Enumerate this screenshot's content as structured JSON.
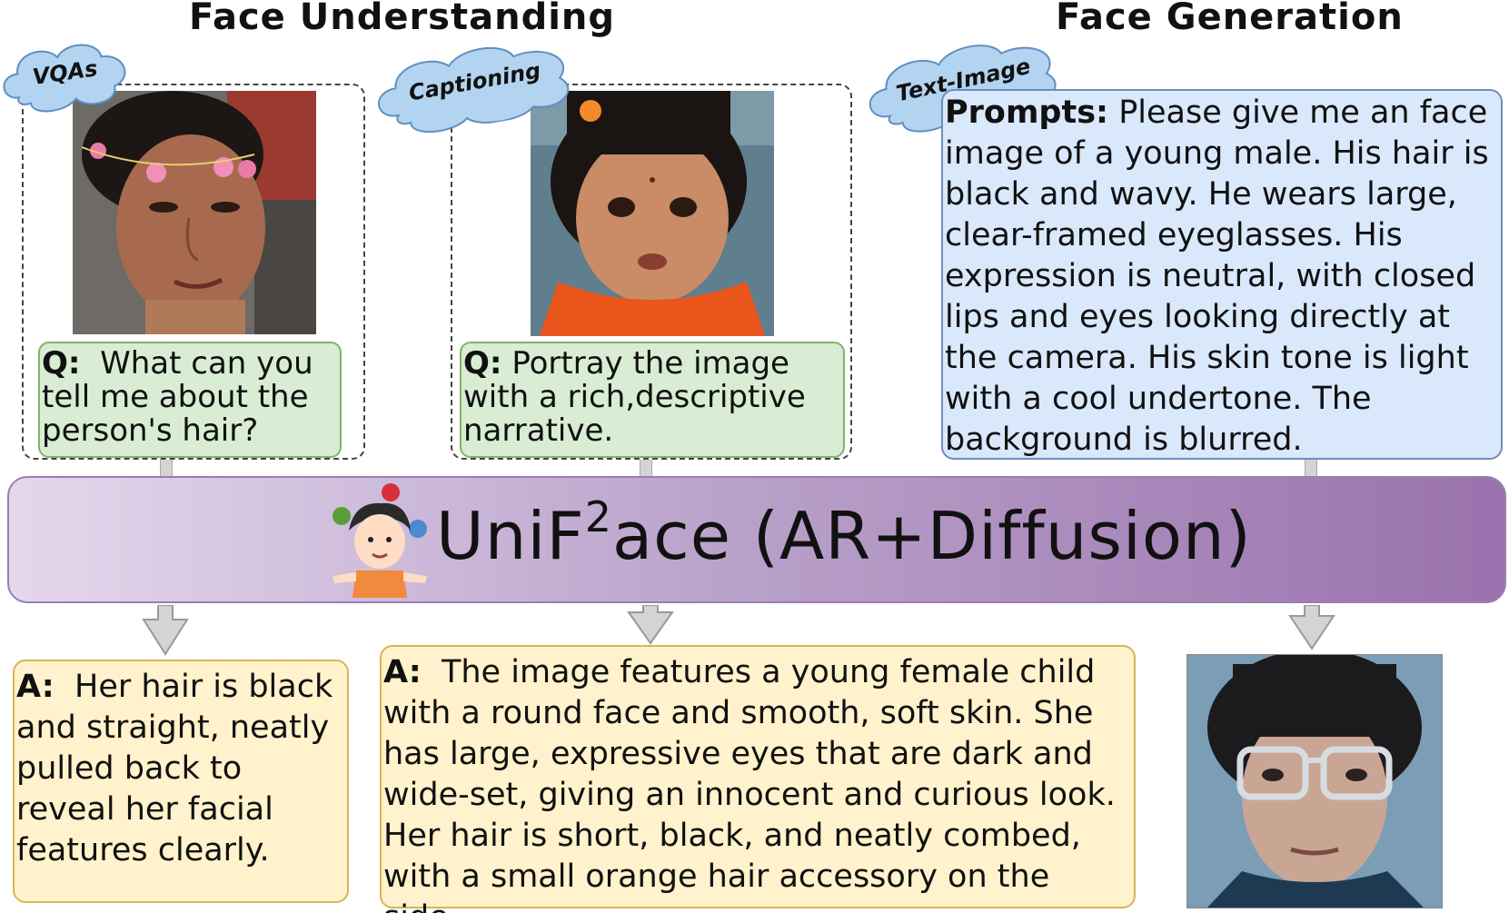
{
  "headings": {
    "understanding": "Face Understanding",
    "generation": "Face Generation"
  },
  "tasks": {
    "vqa": "VQAs",
    "captioning": "Captioning",
    "text_image": "Text-Image"
  },
  "vqa": {
    "question_label": "Q:",
    "question": "What can you tell me about the person's hair?",
    "answer_label": "A:",
    "answer": "Her hair is black and straight, neatly pulled back to reveal her facial features clearly."
  },
  "captioning": {
    "question_label": "Q:",
    "question": "Portray the image with a rich,descriptive narrative.",
    "answer_label": "A:",
    "answer": "The image features a young female child with a round face and smooth, soft skin. She has large, expressive eyes that are dark and wide-set, giving an innocent and curious look. Her hair is short, black, and neatly combed, with a small orange hair accessory on the side."
  },
  "generation": {
    "prompt_label": "Prompts:",
    "prompt": "Please give me an face image of a  young male. His hair is black and wavy. He wears large, clear-framed eyeglasses. His expression is neutral, with closed lips and eyes looking directly at the camera. His skin tone is light with a cool undertone. The background is blurred."
  },
  "model": {
    "name_prefix": "UniF",
    "name_sup": "2",
    "name_suffix": "ace (AR+Diffusion)"
  },
  "colors": {
    "question_fill": "#d8edd4",
    "question_border": "#82b366",
    "answer_fill": "#fff2cc",
    "answer_border": "#d6b656",
    "prompt_fill": "#dae8fc",
    "prompt_border": "#6c8ebf",
    "cloud_fill": "#b3d4f0",
    "banner_left": "#e4d7ec",
    "banner_right": "#9a72ad"
  },
  "icons": {
    "model_icon": "juggler-icon",
    "arrow": "down-arrow-icon"
  }
}
